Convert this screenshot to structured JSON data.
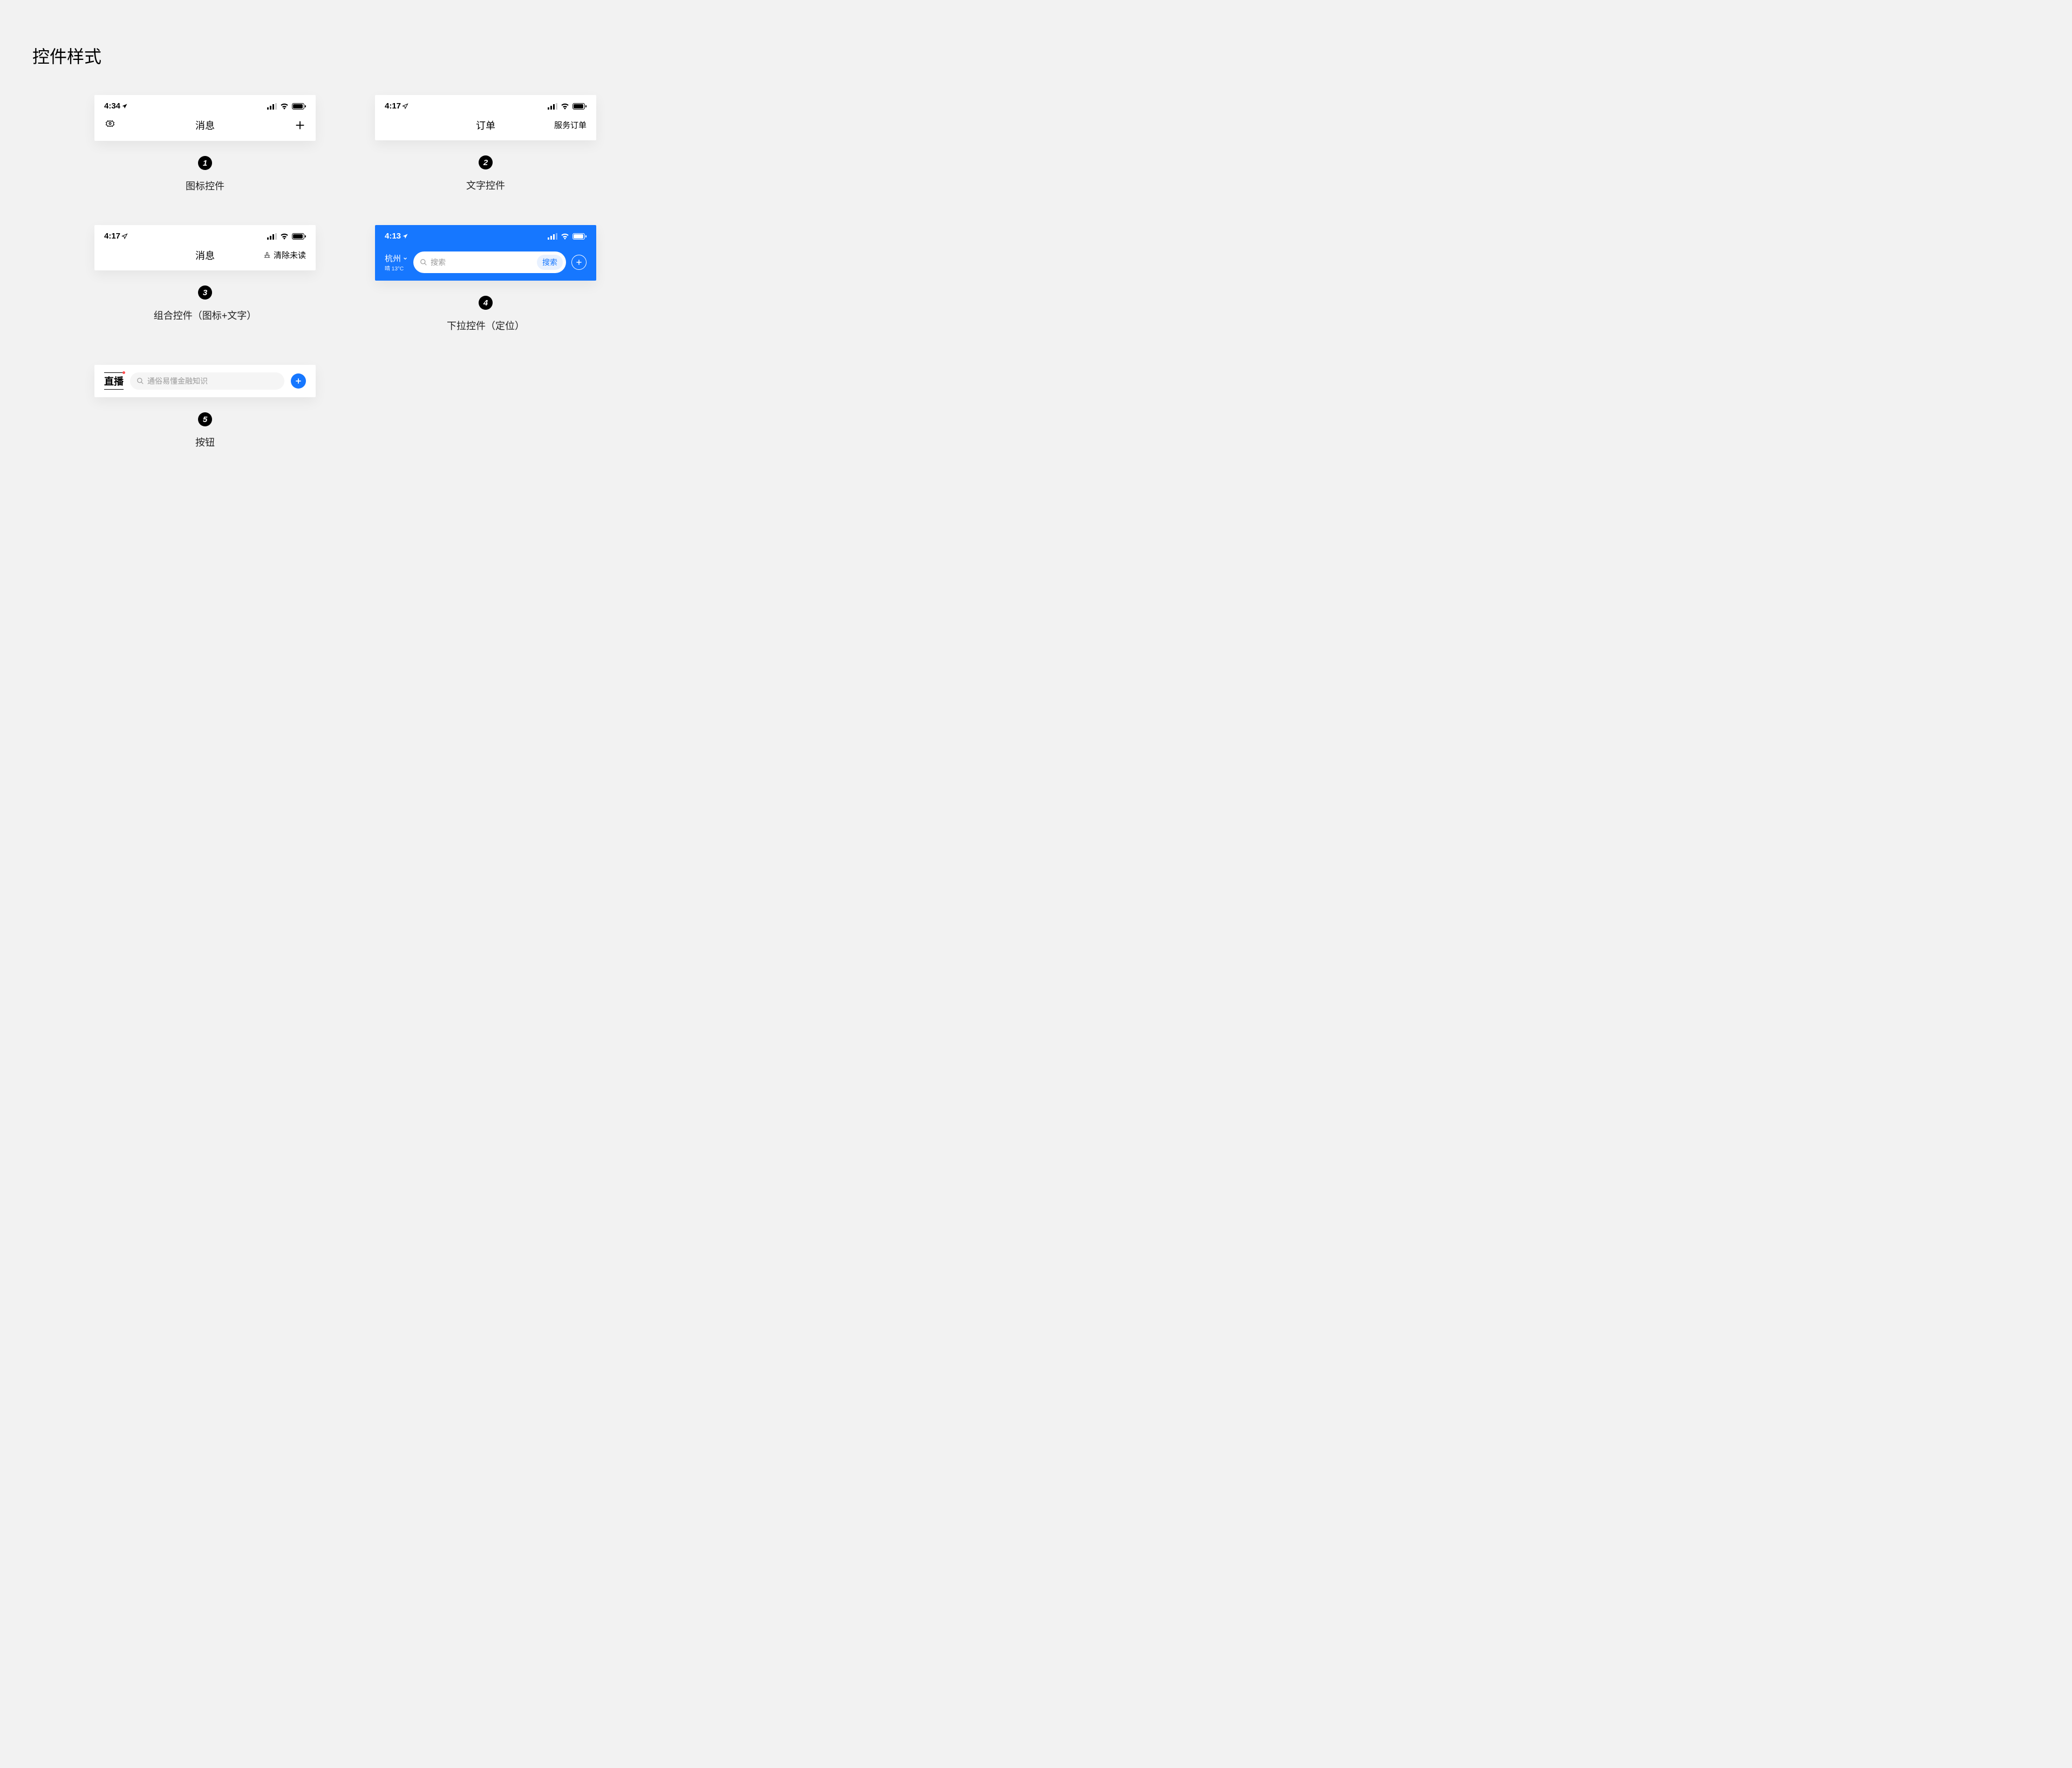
{
  "page_title": "控件样式",
  "samples": {
    "s1": {
      "num": "1",
      "caption": "图标控件",
      "time": "4:34",
      "title": "消息"
    },
    "s2": {
      "num": "2",
      "caption": "文字控件",
      "time": "4:17",
      "title": "订单",
      "right": "服务订单"
    },
    "s3": {
      "num": "3",
      "caption": "组合控件（图标+文字）",
      "time": "4:17",
      "title": "消息",
      "right": "清除未读"
    },
    "s4": {
      "num": "4",
      "caption": "下拉控件（定位）",
      "time": "4:13",
      "location": "杭州",
      "weather": "晴 13°C",
      "search_placeholder": "搜索",
      "search_button": "搜索"
    },
    "s5": {
      "num": "5",
      "caption": "按钮",
      "live": "直播",
      "search_placeholder": "通俗易懂金融知识"
    }
  }
}
